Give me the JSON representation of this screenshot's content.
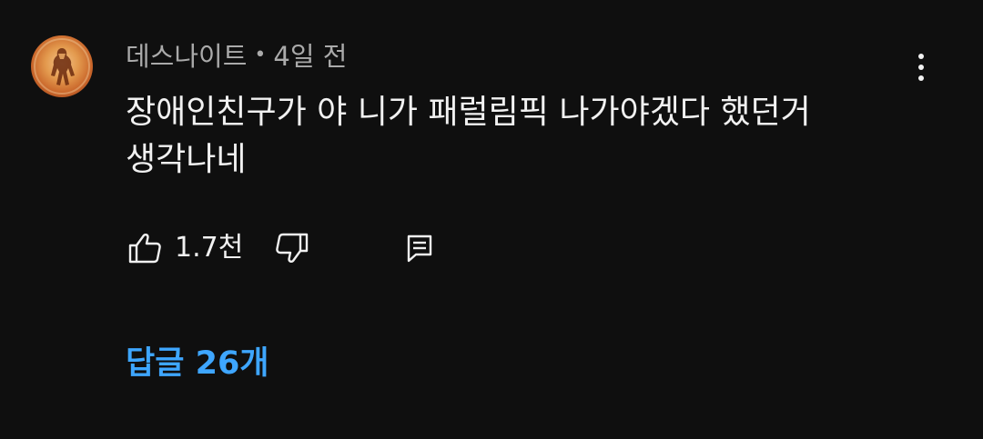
{
  "comment": {
    "author": "데스나이트",
    "separator": "•",
    "timestamp": "4일 전",
    "text": "장애인친구가 야 니가 패럴림픽 나가야겠다 했던거 생각나네",
    "like_count": "1.7천",
    "replies_label": "답글 26개"
  },
  "icons": {
    "avatar": "avatar-image",
    "more": "more-vert-icon",
    "like": "thumbs-up-icon",
    "dislike": "thumbs-down-icon",
    "reply": "reply-comment-icon"
  },
  "colors": {
    "background": "#0f0f0f",
    "primary_text": "#f1f1f1",
    "secondary_text": "#aaaaaa",
    "link": "#3ea6ff"
  }
}
